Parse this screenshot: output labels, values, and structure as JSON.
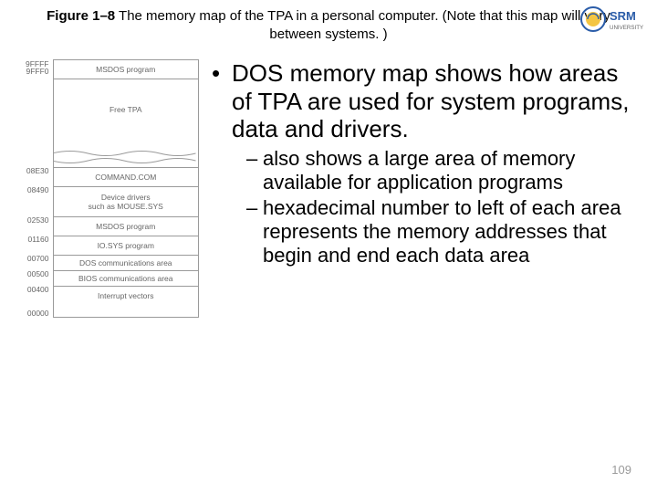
{
  "title": {
    "prefix": "Figure 1–8",
    "main": "  The memory map of the TPA in a personal computer. (Note that this map will vary",
    "line2": "between systems. )"
  },
  "logo": {
    "brand": "SRM",
    "sub": "UNIVERSITY"
  },
  "memory_map": [
    {
      "addr_top": "9FFFF",
      "addr_bot": "9FFF0",
      "label": "MSDOS program"
    },
    {
      "addr_top": "",
      "addr_bot": "",
      "label": "Free TPA"
    },
    {
      "addr_top": "08E30",
      "addr_bot": "",
      "label": "COMMAND.COM"
    },
    {
      "addr_top": "08490",
      "addr_bot": "",
      "label": "Device drivers\nsuch as MOUSE.SYS"
    },
    {
      "addr_top": "02530",
      "addr_bot": "",
      "label": "MSDOS program"
    },
    {
      "addr_top": "01160",
      "addr_bot": "",
      "label": "IO.SYS program"
    },
    {
      "addr_top": "00700",
      "addr_bot": "",
      "label": "DOS communications area"
    },
    {
      "addr_top": "00500",
      "addr_bot": "",
      "label": "BIOS communications area"
    },
    {
      "addr_top": "00400",
      "addr_bot": "00000",
      "label": "Interrupt vectors"
    }
  ],
  "bullets": {
    "main": "DOS memory map shows how areas of TPA are used for system programs, data and drivers.",
    "subs": [
      "also shows a large area of memory available for application programs",
      "hexadecimal number to left of each area represents the memory addresses that begin and end each data area"
    ]
  },
  "page_number": "109"
}
